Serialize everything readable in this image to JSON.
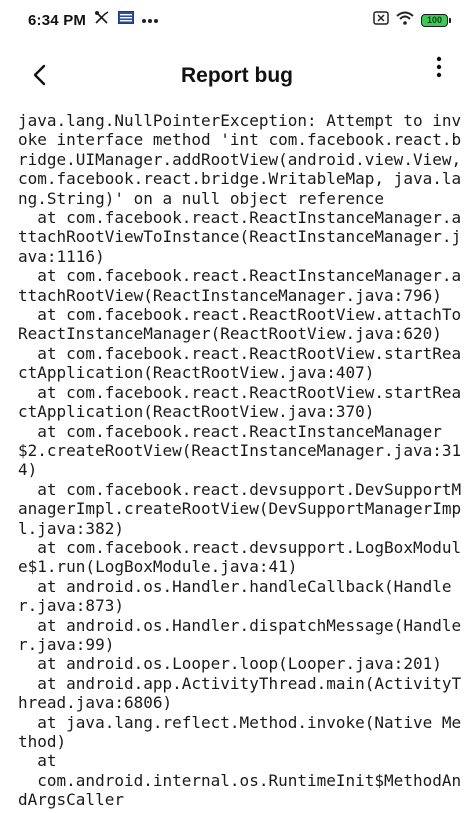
{
  "status_bar": {
    "time": "6:34 PM",
    "battery": "100",
    "icons": [
      "tools-icon",
      "keyboard-icon",
      "more-dots-icon",
      "sim-disabled-icon",
      "wifi-icon",
      "battery-icon"
    ]
  },
  "app_bar": {
    "title": "Report bug",
    "back_icon": "chevron-left-icon",
    "menu_icon": "vertical-dots-icon"
  },
  "report": {
    "text": "java.lang.NullPointerException: Attempt to invoke interface method 'int com.facebook.react.bridge.UIManager.addRootView(android.view.View, com.facebook.react.bridge.WritableMap, java.lang.String)' on a null object reference\n  at com.facebook.react.ReactInstanceManager.attachRootViewToInstance(ReactInstanceManager.java:1116)\n  at com.facebook.react.ReactInstanceManager.attachRootView(ReactInstanceManager.java:796)\n  at com.facebook.react.ReactRootView.attachToReactInstanceManager(ReactRootView.java:620)\n  at com.facebook.react.ReactRootView.startReactApplication(ReactRootView.java:407)\n  at com.facebook.react.ReactRootView.startReactApplication(ReactRootView.java:370)\n  at com.facebook.react.ReactInstanceManager$2.createRootView(ReactInstanceManager.java:314)\n  at com.facebook.react.devsupport.DevSupportManagerImpl.createRootView(DevSupportManagerImpl.java:382)\n  at com.facebook.react.devsupport.LogBoxModule$1.run(LogBoxModule.java:41)\n  at android.os.Handler.handleCallback(Handler.java:873)\n  at android.os.Handler.dispatchMessage(Handler.java:99)\n  at android.os.Looper.loop(Looper.java:201)\n  at android.app.ActivityThread.main(ActivityThread.java:6806)\n  at java.lang.reflect.Method.invoke(Native Method)\n  at\n  com.android.internal.os.RuntimeInit$MethodAndArgsCaller"
  }
}
